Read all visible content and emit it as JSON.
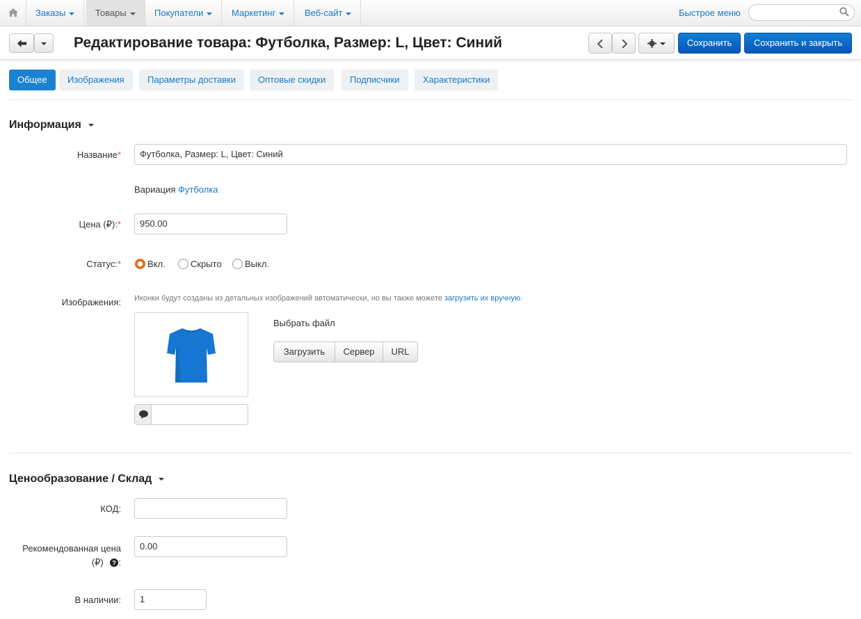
{
  "topnav": {
    "items": [
      {
        "label": "Заказы"
      },
      {
        "label": "Товары"
      },
      {
        "label": "Покупатели"
      },
      {
        "label": "Маркетинг"
      },
      {
        "label": "Веб-сайт"
      }
    ],
    "quick_menu": "Быстрое меню",
    "search_placeholder": ""
  },
  "header": {
    "title": "Редактирование товара: Футболка, Размер: L, Цвет: Синий",
    "save_label": "Сохранить",
    "save_close_label": "Сохранить и закрыть"
  },
  "tabs": [
    {
      "label": "Общее",
      "active": true
    },
    {
      "label": "Изображения"
    },
    {
      "label": "Параметры доставки"
    },
    {
      "label": "Оптовые скидки"
    },
    {
      "label": "Подписчики"
    },
    {
      "label": "Характеристики"
    }
  ],
  "info": {
    "section_title": "Информация",
    "name_label": "Название",
    "name_value": "Футболка, Размер: L, Цвет: Синий",
    "variation_text": "Вариация",
    "variation_link": "Футболка",
    "price_label": "Цена (₽):",
    "price_value": "950.00",
    "status_label": "Статус:",
    "status_options": [
      "Вкл.",
      "Скрыто",
      "Выкл."
    ],
    "status_selected": "Вкл.",
    "images_label": "Изображения:",
    "images_hint": "Иконки будут созданы из детальных изображений автоматически, но вы также можете",
    "images_hint_link": "загрузить их вручную",
    "images_hint_end": ".",
    "choose_file": "Выбрать файл",
    "upload_buttons": [
      "Загрузить",
      "Сервер",
      "URL"
    ],
    "image_alt_value": ""
  },
  "pricing": {
    "section_title": "Ценообразование / Склад",
    "code_label": "КОД:",
    "code_value": "",
    "rec_price_label_line1": "Рекомендованная цена",
    "rec_price_label_line2": "(₽)",
    "rec_price_value": "0.00",
    "in_stock_label": "В наличии:",
    "in_stock_value": "1"
  },
  "colors": {
    "primary": "#0d6fcf",
    "link": "#1a79c6",
    "tshirt": "#1577d1",
    "required": "#d9534f"
  }
}
